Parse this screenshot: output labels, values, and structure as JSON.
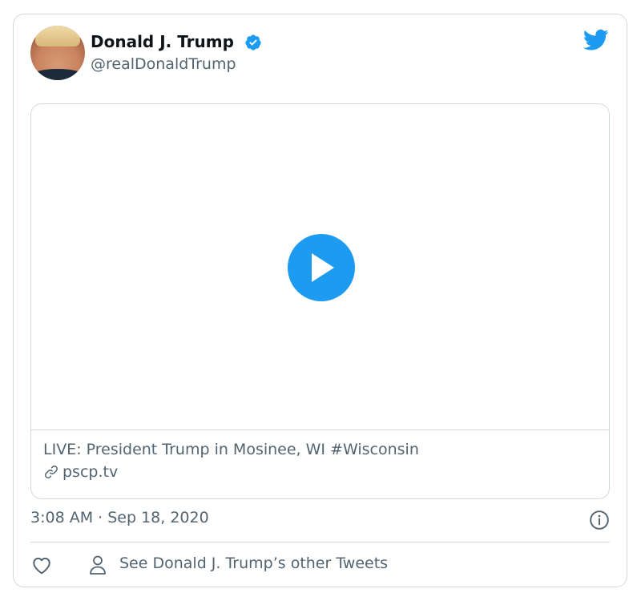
{
  "author": {
    "display_name": "Donald J. Trump",
    "handle": "@realDonaldTrump",
    "verified": true
  },
  "media": {
    "title": "LIVE: President Trump in Mosinee, WI #Wisconsin",
    "link_domain": "pscp.tv"
  },
  "meta": {
    "timestamp": "3:08 AM · Sep 18, 2020"
  },
  "actions": {
    "other_tweets_label": "See Donald J. Trump’s other Tweets"
  },
  "icons": {
    "verified": "verified-badge-icon",
    "brand": "twitter-bird-icon",
    "play": "play-icon",
    "link": "link-icon",
    "info": "info-icon",
    "like": "heart-icon",
    "profile": "person-icon"
  },
  "colors": {
    "accent": "#1d9bf0",
    "text_primary": "#0f1419",
    "text_secondary": "#536471",
    "border": "#cfd9de"
  }
}
